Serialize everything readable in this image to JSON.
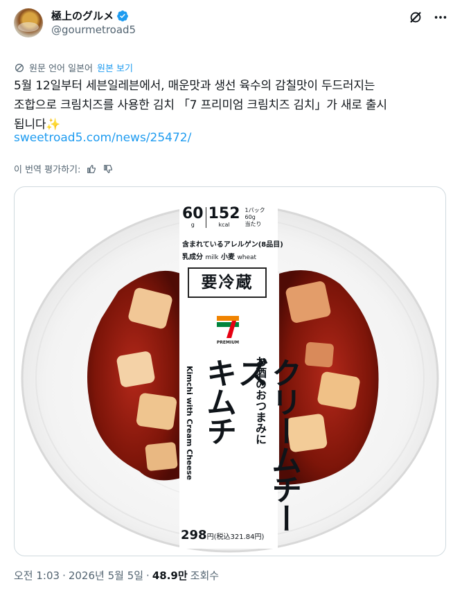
{
  "author": {
    "display_name": "極上のグルメ",
    "handle": "@gourmetroad5"
  },
  "header_icons": [
    "grok-icon",
    "more-icon"
  ],
  "translation": {
    "prefix": "원문 언어 일본어",
    "show_original_label": "원본 보기"
  },
  "tweet": {
    "line1": "5월 12일부터 세븐일레븐에서, 매운맛과 생선 육수의 감칠맛이 두드러지는",
    "line2": "조합으로 크림치즈를 사용한 김치 「7 프리미엄 크림치즈 김치」가 새로 출시",
    "line3": "됩니다",
    "emoji": "✨",
    "link": "sweetroad5.com/news/25472/"
  },
  "rate_translation_label": "이 번역 평가하기:",
  "product_label": {
    "protein": "60",
    "protein_unit": "g",
    "calories": "152",
    "calories_unit": "kcal",
    "per_pack": "1パック60g\n当たり",
    "allergen_title": "含まれているアレルゲン(8品目)",
    "allergen_jp1": "乳成分",
    "allergen_en1": "milk",
    "allergen_jp2": "小麦",
    "allergen_en2": "wheat",
    "refrigerate": "要冷蔵",
    "brand": "PREMIUM",
    "subtitle": "お酒のおつまみに",
    "title1": "クリームチーズ",
    "title2": "キムチ",
    "english_name": "Kimchi with Cream Cheese",
    "price": "298",
    "price_unit": "円",
    "price_tax": "(税込321.84円)"
  },
  "footer": {
    "time": "오전 1:03",
    "sep1": "·",
    "date": "2026년 5월 5일",
    "sep2": "·",
    "views": "48.9만",
    "views_label": "조회수"
  },
  "colors": {
    "link": "#1d9bf0",
    "secondary_text": "#536471",
    "verified": "#1d9bf0",
    "kimchi_red": "#8e1a12",
    "seven_orange": "#f08300",
    "seven_green": "#00843d",
    "seven_red": "#e60012"
  }
}
